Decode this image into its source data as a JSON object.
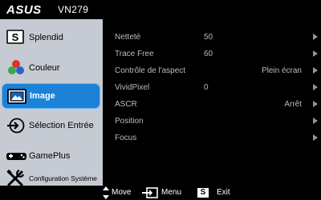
{
  "titlebar": {
    "brand": "ASUS",
    "model": "VN279"
  },
  "sidebar": {
    "items": [
      {
        "label": "Splendid",
        "icon": "splendid-icon",
        "active": false
      },
      {
        "label": "Couleur",
        "icon": "color-palette-icon",
        "active": false
      },
      {
        "label": "Image",
        "icon": "image-icon",
        "active": true
      },
      {
        "label": "Sélection Entrée",
        "icon": "input-select-icon",
        "active": false
      },
      {
        "label": "GamePlus",
        "icon": "gamepad-icon",
        "active": false
      },
      {
        "label": "Configuration Système",
        "icon": "tools-icon",
        "active": false
      }
    ]
  },
  "settings": {
    "rows": [
      {
        "label": "Netteté",
        "value": "50"
      },
      {
        "label": "Trace Free",
        "value": "60"
      },
      {
        "label": "Contrôle de l'aspect",
        "value": "Plein écran"
      },
      {
        "label": "VividPixel",
        "value": "0"
      },
      {
        "label": "ASCR",
        "value": "Arrêt"
      },
      {
        "label": "Position",
        "value": ""
      },
      {
        "label": "Focus",
        "value": ""
      }
    ]
  },
  "bottom_bar": {
    "move_label": "Move",
    "menu_label": "Menu",
    "exit_key": "S",
    "exit_label": "Exit"
  },
  "colors": {
    "sidebar_bg": "#c6cbd3",
    "active_bg": "#1b82d7",
    "panel_bg": "#000000",
    "text_light": "#b8bcc2"
  }
}
